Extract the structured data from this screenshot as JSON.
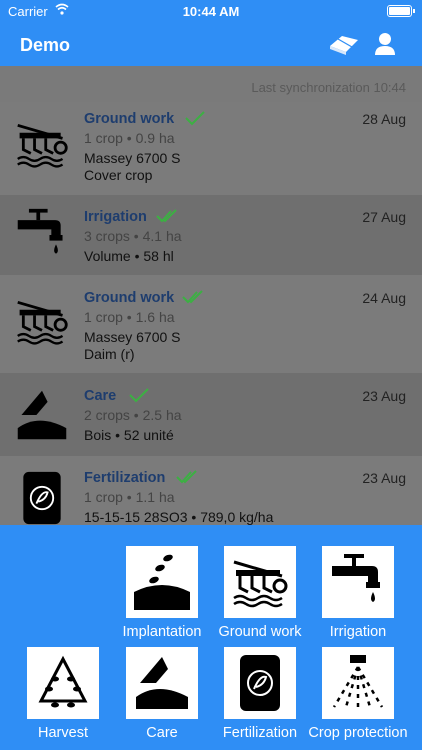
{
  "status": {
    "carrier": "Carrier",
    "time": "10:44 AM",
    "battery_level": 0.9
  },
  "nav": {
    "title": "Demo"
  },
  "sync": {
    "text": "Last synchronization 10:44"
  },
  "colors": {
    "accent": "#2f8ef5",
    "check": "#3cb043",
    "type_text": "#1e3d6e"
  },
  "activities": [
    {
      "type": "Ground work",
      "check": "single",
      "date": "28 Aug",
      "summary": "1 crop • 0.9 ha",
      "detail1": "Massey 6700 S",
      "detail2": "Cover crop",
      "icon": "plough-icon"
    },
    {
      "type": "Irrigation",
      "check": "double",
      "date": "27 Aug",
      "summary": "3 crops • 4.1 ha",
      "detail1": "Volume • 58 hl",
      "detail2": "",
      "icon": "faucet-icon"
    },
    {
      "type": "Ground work",
      "check": "double",
      "date": "24 Aug",
      "summary": "1 crop • 1.6 ha",
      "detail1": "Massey 6700 S",
      "detail2": "Daim (r)",
      "icon": "plough-icon"
    },
    {
      "type": "Care",
      "check": "single",
      "date": "23 Aug",
      "summary": "2 crops • 2.5 ha",
      "detail1": "Bois • 52 unité",
      "detail2": "",
      "icon": "care-icon"
    },
    {
      "type": "Fertilization",
      "check": "double",
      "date": "23 Aug",
      "summary": "1 crop • 1.1 ha",
      "detail1": "15-15-15 28SO3 • 789,0 kg/ha",
      "detail2": "",
      "icon": "fertilizer-bag-icon"
    }
  ],
  "panel": {
    "tiles": [
      {
        "label": "Implantation",
        "icon": "seeding-icon"
      },
      {
        "label": "Ground work",
        "icon": "plough-icon"
      },
      {
        "label": "Irrigation",
        "icon": "faucet-icon"
      },
      {
        "label": "Harvest",
        "icon": "wheat-icon"
      },
      {
        "label": "Care",
        "icon": "care-icon"
      },
      {
        "label": "Fertilization",
        "icon": "fertilizer-bag-icon"
      },
      {
        "label": "Crop protection",
        "icon": "sprayer-icon"
      }
    ]
  }
}
